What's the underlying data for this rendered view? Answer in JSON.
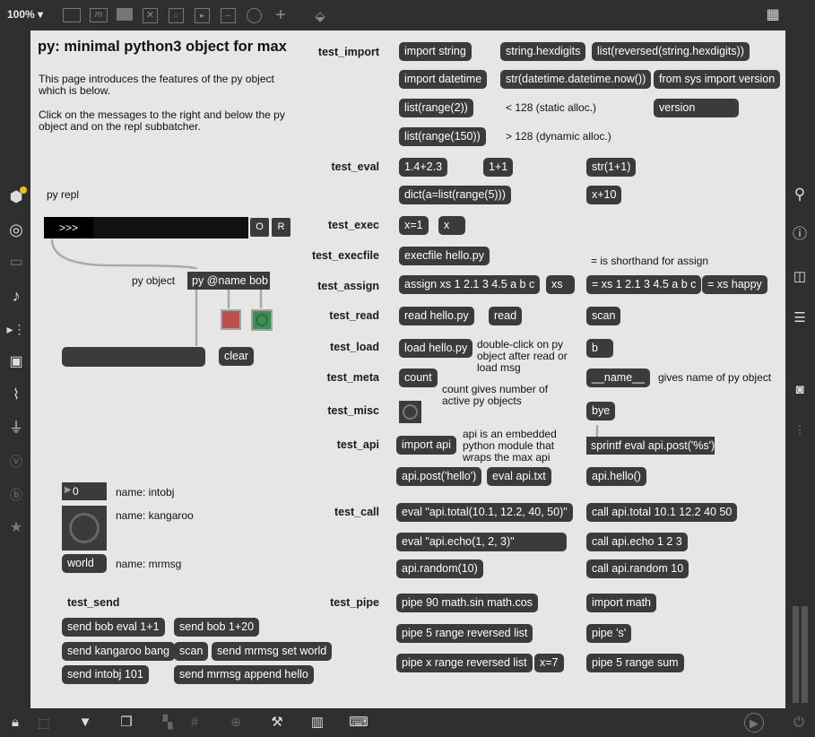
{
  "toolbar": {
    "zoom": "100%"
  },
  "page": {
    "title": "py: minimal python3 object for max",
    "intro1": "This page introduces the features of the py object which is below.",
    "intro2": "Click on the messages to the right and below the py object and on the repl subbatcher.",
    "py_repl_label": "py repl",
    "repl_prompt": ">>>",
    "repl_o": "O",
    "repl_r": "R",
    "py_object_label": "py object",
    "py_object_text": "py @name bob",
    "clear_label": "clear",
    "intobj_value": "0",
    "intobj_name": "name: intobj",
    "kangaroo_name": "name: kangaroo",
    "mrmsg_value": "world",
    "mrmsg_name": "name: mrmsg"
  },
  "tests": {
    "import": "test_import",
    "eval": "test_eval",
    "exec": "test_exec",
    "execfile": "test_execfile",
    "assign": "test_assign",
    "read": "test_read",
    "load": "test_load",
    "meta": "test_meta",
    "misc": "test_misc",
    "api": "test_api",
    "call": "test_call",
    "pipe": "test_pipe",
    "send": "test_send"
  },
  "messages": {
    "import_string": "import string",
    "string_hexdigits": "string.hexdigits",
    "list_reversed": "list(reversed(string.hexdigits))",
    "import_datetime": "import datetime",
    "str_datetime": "str(datetime.datetime.now())",
    "from_sys": "from sys import version",
    "list_range2": "list(range(2))",
    "version": "version",
    "list_range150": "list(range(150))",
    "eval_14_23": "1.4+2.3",
    "eval_1p1": "1+1",
    "str_1p1": "str(1+1)",
    "dict_a": "dict(a=list(range(5)))",
    "x_plus_10": "x+10",
    "x_eq_1": "x=1",
    "x": "x",
    "execfile_hello": "execfile hello.py",
    "assign_xs": "assign xs 1 2.1 3 4.5 a b c",
    "xs": "xs",
    "eq_xs": "= xs 1 2.1 3 4.5 a b c",
    "eq_xs_happy": "= xs happy",
    "read_hello": "read hello.py",
    "read": "read",
    "scan": "scan",
    "load_hello": "load hello.py",
    "b": "b",
    "count": "count",
    "name_dunder": "__name__",
    "bye": "bye",
    "import_api": "import api",
    "sprintf": "sprintf eval api.post('%s')",
    "api_post_hello": "api.post('hello')",
    "eval_api_txt": "eval api.txt",
    "api_hello": "api.hello()",
    "eval_api_total": "eval \"api.total(10.1, 12.2, 40, 50)\"",
    "call_api_total": "call api.total 10.1 12.2 40 50",
    "eval_api_echo": "eval \"api.echo(1, 2, 3)\"",
    "call_api_echo": "call api.echo 1 2 3",
    "api_random": "api.random(10)",
    "call_api_random": "call api.random 10",
    "pipe_90": "pipe 90 math.sin math.cos",
    "import_math": "import math",
    "pipe_5_range_rev": "pipe 5 range reversed list",
    "pipe_s": "pipe 's'",
    "pipe_x_range_rev": "pipe x range reversed list",
    "x_eq_7": "x=7",
    "pipe_5_range_sum": "pipe 5 range sum",
    "send_bob_eval": "send bob eval 1+1",
    "send_bob_plus": "send bob 1+20",
    "send_kangaroo_bang": "send kangaroo bang",
    "scan2": "scan",
    "send_mrmsg_set": "send mrmsg set world",
    "send_intobj": "send intobj 101",
    "send_mrmsg_append": "send mrmsg append hello"
  },
  "comments": {
    "static_alloc": "< 128 (static alloc.)",
    "dynamic_alloc": "> 128 (dynamic alloc.)",
    "shorthand": "= is shorthand for assign",
    "double_click": "double-click on py object after read or load msg",
    "gives_name": "gives name of py object",
    "count_gives": "count gives number of active  py objects",
    "api_embedded": "api is an embedded python module that wraps the max api"
  },
  "colors": {
    "canvas_bg": "#e6e6e6",
    "message_bg": "#3b3b3b",
    "toolbar_bg": "#2f2f2f",
    "red_toggle": "#a84a4a",
    "green_toggle": "#3a8a4a",
    "accent_badge": "#e8c020"
  },
  "icons": {
    "left": [
      "package-icon",
      "target-icon",
      "monitor-icon",
      "music-note-icon",
      "step-icon",
      "image-icon",
      "paperclip-icon",
      "plug-icon",
      "v-icon",
      "b-icon",
      "star-icon"
    ],
    "right": [
      "search-icon",
      "info-icon",
      "columns-icon",
      "list-icon",
      "camera-icon",
      "sliders-icon"
    ]
  }
}
